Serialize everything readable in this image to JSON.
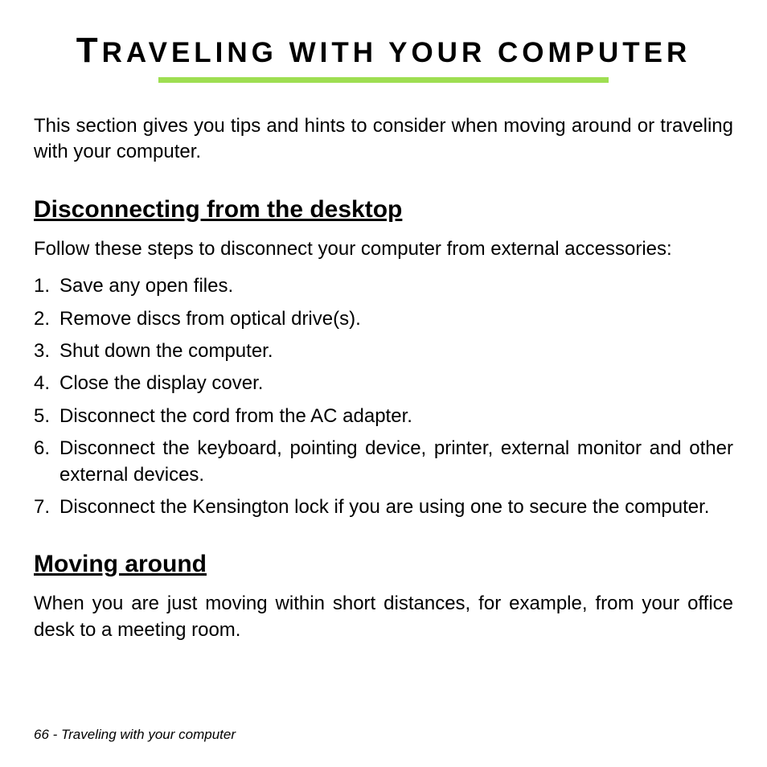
{
  "title_first": "T",
  "title_rest": "raveling with your computer",
  "intro": "This section gives you tips and hints to consider when moving around or traveling with your computer.",
  "section1": {
    "heading": "Disconnecting from the desktop",
    "intro": "Follow these steps to disconnect your computer from external accessories:",
    "steps": [
      "Save any open files.",
      "Remove discs from optical drive(s).",
      "Shut down the computer.",
      "Close the display cover.",
      "Disconnect the cord from the AC adapter.",
      "Disconnect the keyboard, pointing device, printer, external monitor and other external devices.",
      "Disconnect the Kensington lock if you are using one to secure the computer."
    ]
  },
  "section2": {
    "heading": "Moving around",
    "intro": "When you are just moving within short distances, for example, from your office desk to a meeting room."
  },
  "footer": "66 - Traveling with your computer"
}
